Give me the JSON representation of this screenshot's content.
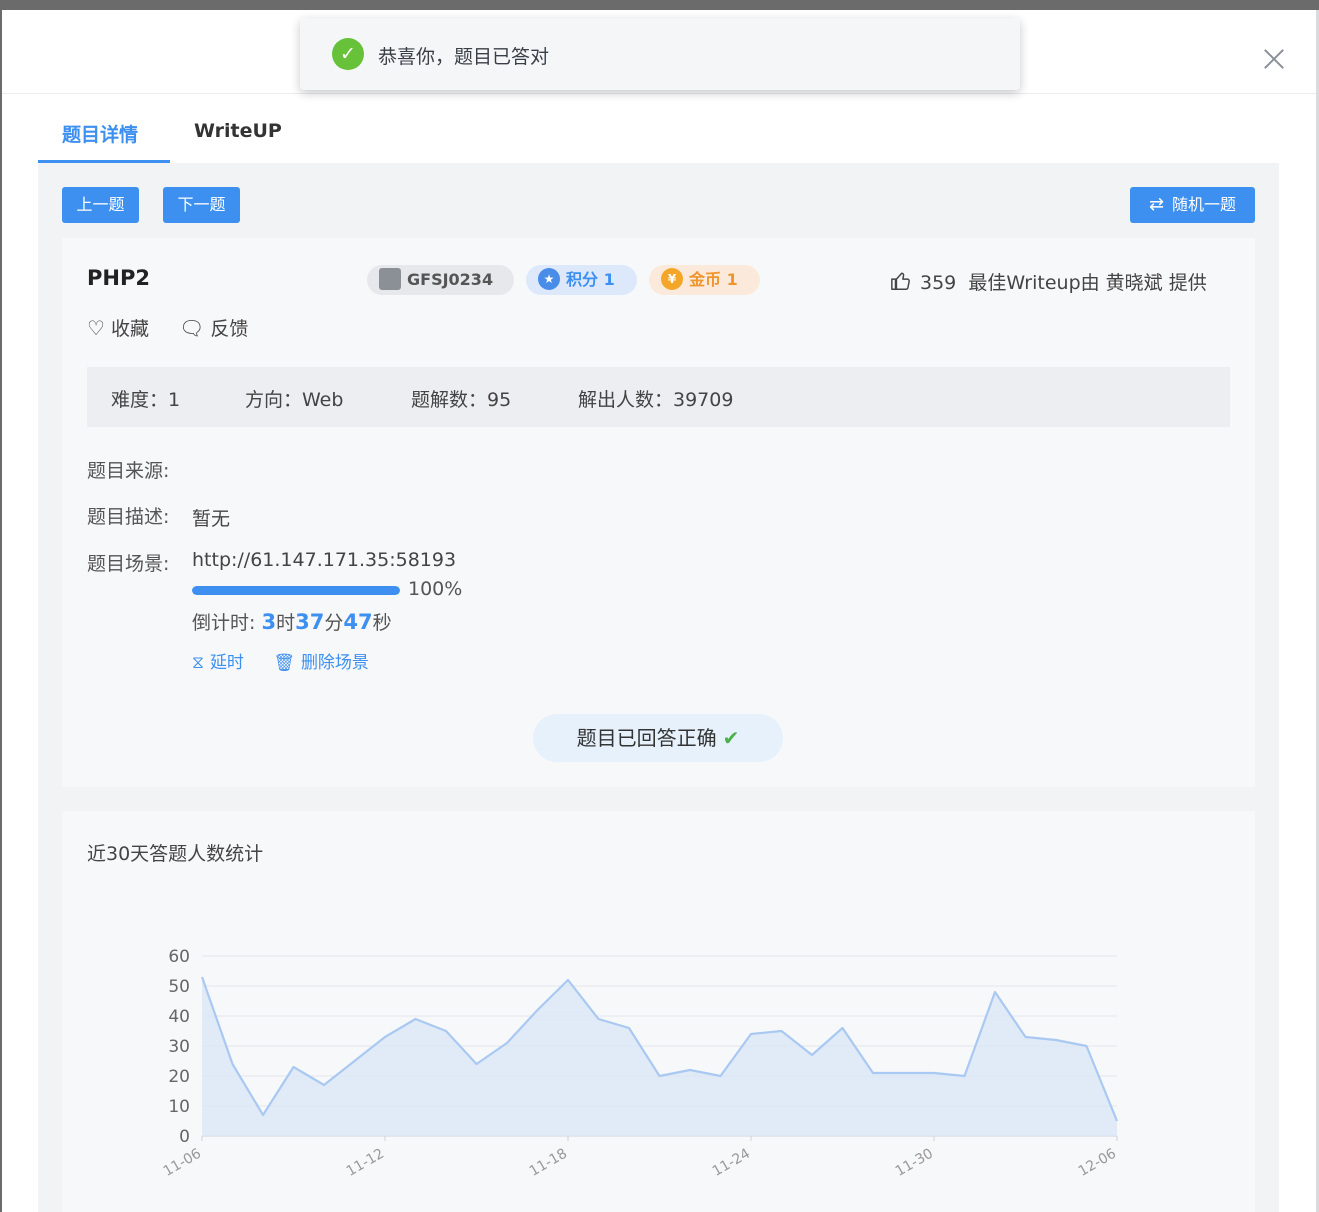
{
  "toast": {
    "icon": "check-circle-icon",
    "message": "恭喜你，题目已答对"
  },
  "tabs": [
    {
      "label": "题目详情",
      "active": true
    },
    {
      "label": "WriteUP",
      "active": false
    }
  ],
  "toolbar": {
    "prev_label": "上一题",
    "next_label": "下一题",
    "random_label": "随机一题",
    "random_icon": "shuffle-icon"
  },
  "challenge": {
    "title": "PHP2",
    "id_badge": "GFSJ0234",
    "score_badge": "积分 1",
    "coin_badge": "金币 1",
    "likes": "359",
    "writeup_credit": "最佳Writeup由 黄晓斌 提供",
    "favorite_label": "收藏",
    "feedback_label": "反馈",
    "meta": {
      "difficulty": "难度：1",
      "direction": "方向：Web",
      "solve_count": "题解数：95",
      "solver_count": "解出人数：39709"
    },
    "source_label": "题目来源:",
    "source_value": "",
    "desc_label": "题目描述:",
    "desc_value": "暂无",
    "scene_label": "题目场景:",
    "scene_url": "http://61.147.171.35:58193",
    "progress": 100,
    "progress_text": "100%",
    "countdown_label": "倒计时: ",
    "countdown_h": "3",
    "countdown_h_unit": "时",
    "countdown_m": "37",
    "countdown_m_unit": "分",
    "countdown_s": "47",
    "countdown_s_unit": "秒",
    "extend_label": "延时",
    "delete_label": "删除场景",
    "answered_label": "题目已回答正确"
  },
  "chart_data": {
    "type": "area",
    "title": "近30天答题人数统计",
    "x": [
      "11-06",
      "11-07",
      "11-08",
      "11-09",
      "11-10",
      "11-11",
      "11-12",
      "11-13",
      "11-14",
      "11-15",
      "11-16",
      "11-17",
      "11-18",
      "11-19",
      "11-20",
      "11-21",
      "11-22",
      "11-23",
      "11-24",
      "11-25",
      "11-26",
      "11-27",
      "11-28",
      "11-29",
      "11-30",
      "12-01",
      "12-02",
      "12-03",
      "12-04",
      "12-05",
      "12-06"
    ],
    "x_tick_labels": [
      "11-06",
      "11-12",
      "11-18",
      "11-24",
      "11-30",
      "12-06"
    ],
    "y_ticks": [
      0,
      10,
      20,
      30,
      40,
      50,
      60
    ],
    "ylim": [
      0,
      60
    ],
    "series": [
      {
        "values": [
          53,
          24,
          7,
          23,
          17,
          25,
          33,
          39,
          35,
          24,
          31,
          42,
          52,
          39,
          36,
          20,
          22,
          20,
          34,
          35,
          27,
          36,
          21,
          21,
          21,
          20,
          48,
          33,
          32,
          30,
          5
        ],
        "color": "#a9c9f2"
      }
    ],
    "grid": true
  }
}
